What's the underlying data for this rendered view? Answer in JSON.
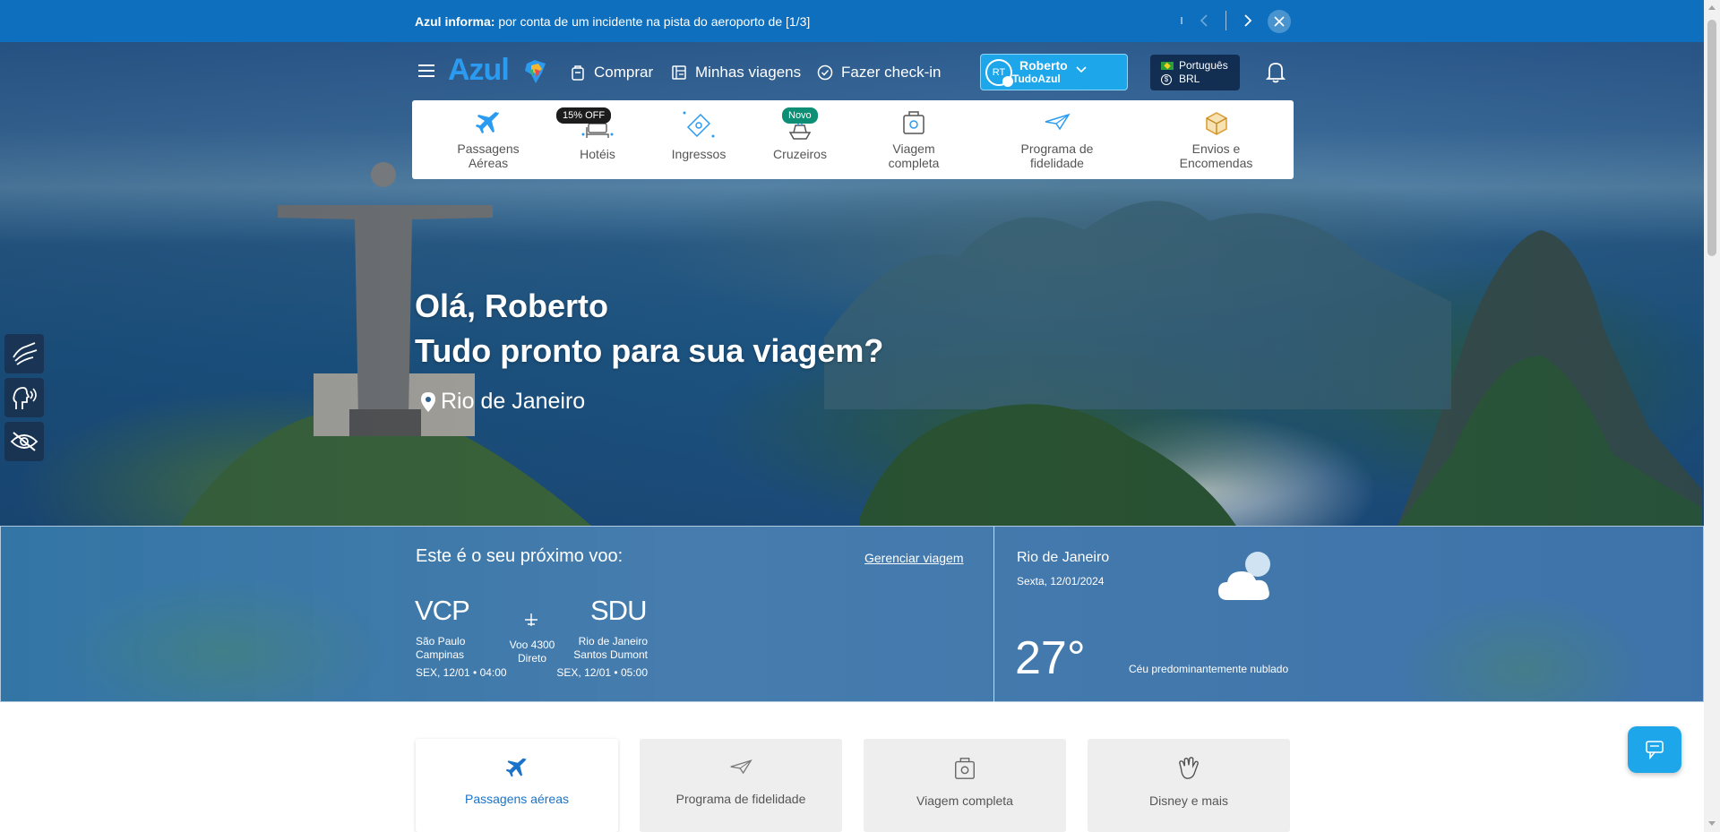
{
  "alert": {
    "prefix": "Azul informa:",
    "message": "por conta de um incidente na pista do aeroporto de [1/3]"
  },
  "header": {
    "logo": "Azul",
    "nav": [
      {
        "label": "Comprar",
        "icon": "cart-icon"
      },
      {
        "label": "Minhas viagens",
        "icon": "trips-icon"
      },
      {
        "label": "Fazer check-in",
        "icon": "checkin-icon"
      }
    ],
    "user": {
      "initials": "RT",
      "name": "Roberto",
      "program": "TudoAzul"
    },
    "language": {
      "label": "Português",
      "currency": "BRL"
    }
  },
  "products": [
    {
      "label": "Passagens Aéreas",
      "icon": "airplane-icon",
      "tag": ""
    },
    {
      "label": "Hotéis",
      "icon": "hotel-bed-icon",
      "tag": "15% OFF"
    },
    {
      "label": "Ingressos",
      "icon": "ticket-icon",
      "tag": ""
    },
    {
      "label": "Cruzeiros",
      "icon": "cruise-ship-icon",
      "tag": "Novo"
    },
    {
      "label": "Viagem completa",
      "icon": "luggage-icon",
      "tag": ""
    },
    {
      "label": "Programa de fidelidade",
      "icon": "paper-plane-icon",
      "tag": ""
    },
    {
      "label": "Envios e Encomendas",
      "icon": "package-icon",
      "tag": ""
    }
  ],
  "greeting": {
    "line1": "Olá, Roberto",
    "line2": "Tudo pronto para sua viagem?",
    "location": "Rio de Janeiro"
  },
  "next_flight": {
    "title": "Este é o seu próximo voo:",
    "manage": "Gerenciar viagem",
    "origin": {
      "code": "VCP",
      "city_line1": "São Paulo",
      "city_line2": "Campinas",
      "datetime": "SEX, 12/01 • 04:00"
    },
    "destination": {
      "code": "SDU",
      "city_line1": "Rio de Janeiro",
      "city_line2": "Santos Dumont",
      "datetime": "SEX, 12/01 • 05:00"
    },
    "flight_line1": "Voo 4300",
    "flight_line2": "Direto"
  },
  "weather": {
    "city": "Rio de Janeiro",
    "date": "Sexta, 12/01/2024",
    "temperature": "27°",
    "description": "Céu predominantemente nublado",
    "icon": "partly-cloudy-icon"
  },
  "tabs": [
    {
      "label": "Passagens aéreas",
      "icon": "airplane-icon",
      "active": true
    },
    {
      "label": "Programa de fidelidade",
      "icon": "paper-plane-icon",
      "active": false
    },
    {
      "label": "Viagem completa",
      "icon": "luggage-icon",
      "active": false
    },
    {
      "label": "Disney e mais",
      "icon": "glove-icon",
      "active": false
    }
  ],
  "colors": {
    "brand_blue": "#1ea6ea",
    "alert_blue": "#0d6fbe",
    "active_tab_text": "#1a73c8",
    "tag_green": "#0c8f74"
  }
}
